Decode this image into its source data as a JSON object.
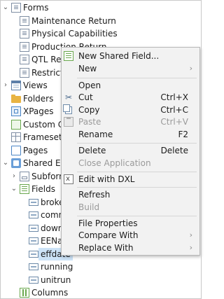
{
  "tree": {
    "items": [
      {
        "label": "Forms",
        "icon": "form-icon",
        "twisty": "expanded"
      },
      {
        "label": "Maintenance Return",
        "icon": "form-icon",
        "twisty": ""
      },
      {
        "label": "Physical Capabilities",
        "icon": "form-icon",
        "twisty": ""
      },
      {
        "label": "Production Return",
        "icon": "form-icon",
        "twisty": ""
      },
      {
        "label": "QTL Ret",
        "icon": "form-icon",
        "twisty": ""
      },
      {
        "label": "Restricte",
        "icon": "form-icon",
        "twisty": ""
      },
      {
        "label": "Views",
        "icon": "views-icon",
        "twisty": "collapsed"
      },
      {
        "label": "Folders",
        "icon": "folder-icon",
        "twisty": ""
      },
      {
        "label": "XPages",
        "icon": "xpages-icon",
        "twisty": ""
      },
      {
        "label": "Custom Co",
        "icon": "custom-controls-icon",
        "twisty": ""
      },
      {
        "label": "Framesets",
        "icon": "frameset-icon",
        "twisty": ""
      },
      {
        "label": "Pages",
        "icon": "page-icon",
        "twisty": ""
      },
      {
        "label": "Shared Elem",
        "icon": "shared-elements-icon",
        "twisty": "expanded"
      },
      {
        "label": "Subform",
        "icon": "subform-icon",
        "twisty": "collapsed"
      },
      {
        "label": "Fields",
        "icon": "fields-icon",
        "twisty": "expanded"
      },
      {
        "label": "broke",
        "icon": "field-icon",
        "twisty": ""
      },
      {
        "label": "comn",
        "icon": "field-icon",
        "twisty": ""
      },
      {
        "label": "down",
        "icon": "field-icon",
        "twisty": ""
      },
      {
        "label": "EENar",
        "icon": "field-icon",
        "twisty": ""
      },
      {
        "label": "effdate",
        "icon": "field-icon",
        "twisty": "",
        "selected": true
      },
      {
        "label": "running",
        "icon": "field-icon",
        "twisty": ""
      },
      {
        "label": "unitrun",
        "icon": "field-icon",
        "twisty": ""
      },
      {
        "label": "Columns",
        "icon": "columns-icon",
        "twisty": ""
      }
    ]
  },
  "menu": {
    "items": [
      {
        "label": "New Shared Field...",
        "shortcut": "",
        "icon": "new-shared-field-icon",
        "enabled": true,
        "submenu": false
      },
      {
        "label": "New",
        "shortcut": "",
        "icon": "",
        "enabled": true,
        "submenu": true
      },
      {
        "sep": true
      },
      {
        "label": "Open",
        "shortcut": "",
        "icon": "",
        "enabled": true,
        "submenu": false
      },
      {
        "label": "Cut",
        "shortcut": "Ctrl+X",
        "icon": "scissors-icon",
        "enabled": true,
        "submenu": false
      },
      {
        "label": "Copy",
        "shortcut": "Ctrl+C",
        "icon": "copy-icon",
        "enabled": true,
        "submenu": false
      },
      {
        "label": "Paste",
        "shortcut": "Ctrl+V",
        "icon": "paste-icon",
        "enabled": false,
        "submenu": false
      },
      {
        "label": "Rename",
        "shortcut": "F2",
        "icon": "",
        "enabled": true,
        "submenu": false
      },
      {
        "sep": true
      },
      {
        "label": "Delete",
        "shortcut": "Delete",
        "icon": "",
        "enabled": true,
        "submenu": false
      },
      {
        "label": "Close Application",
        "shortcut": "",
        "icon": "",
        "enabled": false,
        "submenu": false
      },
      {
        "sep": true
      },
      {
        "label": "Edit with DXL",
        "shortcut": "",
        "icon": "dxl-icon",
        "enabled": true,
        "submenu": false
      },
      {
        "sep": true
      },
      {
        "label": "Refresh",
        "shortcut": "",
        "icon": "",
        "enabled": true,
        "submenu": false
      },
      {
        "label": "Build",
        "shortcut": "",
        "icon": "",
        "enabled": false,
        "submenu": false
      },
      {
        "sep": true
      },
      {
        "label": "File Properties",
        "shortcut": "",
        "icon": "",
        "enabled": true,
        "submenu": false
      },
      {
        "label": "Compare With",
        "shortcut": "",
        "icon": "",
        "enabled": true,
        "submenu": true
      },
      {
        "label": "Replace With",
        "shortcut": "",
        "icon": "",
        "enabled": true,
        "submenu": true
      }
    ]
  }
}
